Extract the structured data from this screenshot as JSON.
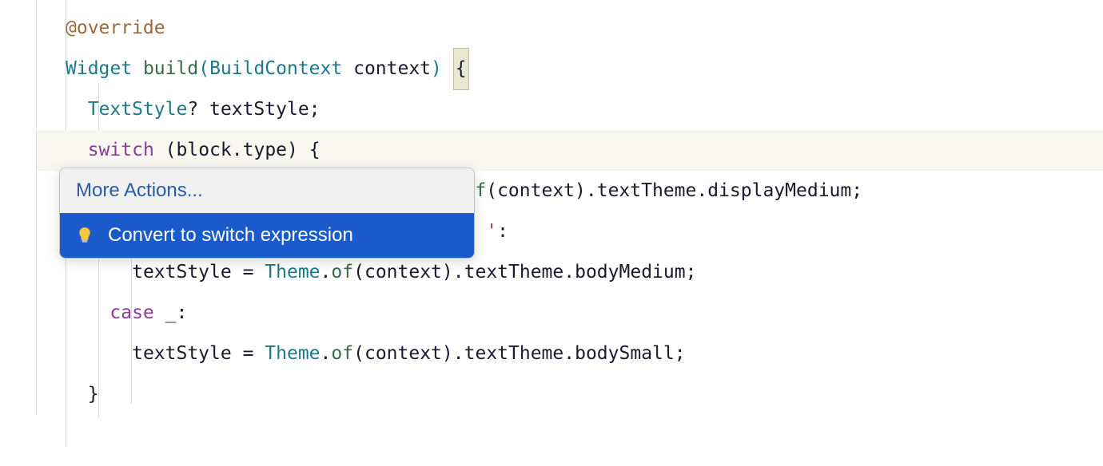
{
  "code": {
    "line1": {
      "annotation": "@override"
    },
    "line2": {
      "type1": "Widget",
      "method": "build",
      "paren_open": "(",
      "type2": "BuildContext",
      "param": "context",
      "paren_close": ")",
      "brace": "{"
    },
    "line3": {
      "type": "TextStyle",
      "nullable": "?",
      "var": "textStyle",
      "semi": ";"
    },
    "line4": {
      "keyword": "switch",
      "paren_open": "(",
      "obj": "block",
      "dot": ".",
      "prop": "type",
      "paren_close": ")",
      "brace": "{"
    },
    "line5_partial": {
      "method": "f",
      "paren_open": "(",
      "arg": "context",
      "paren_close": ")",
      "dot1": ".",
      "prop1": "textTheme",
      "dot2": ".",
      "prop2": "displayMedium",
      "semi": ";"
    },
    "line6_partial": {
      "quote": "'",
      "colon": ":"
    },
    "line7": {
      "var": "textStyle",
      "eq": "=",
      "type": "Theme",
      "dot1": ".",
      "method": "of",
      "paren_open": "(",
      "arg": "context",
      "paren_close": ")",
      "dot2": ".",
      "prop1": "textTheme",
      "dot3": ".",
      "prop2": "bodyMedium",
      "semi": ";"
    },
    "line8": {
      "keyword": "case",
      "wildcard": "_",
      "colon": ":"
    },
    "line9": {
      "var": "textStyle",
      "eq": "=",
      "type": "Theme",
      "dot1": ".",
      "method": "of",
      "paren_open": "(",
      "arg": "context",
      "paren_close": ")",
      "dot2": ".",
      "prop1": "textTheme",
      "dot3": ".",
      "prop2": "bodySmall",
      "semi": ";"
    },
    "line10": {
      "brace": "}"
    }
  },
  "popup": {
    "header": "More Actions...",
    "item": "Convert to switch expression"
  }
}
